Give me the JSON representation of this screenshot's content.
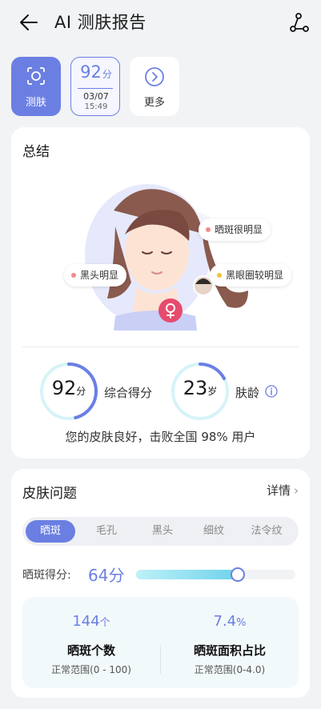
{
  "header": {
    "title": "AI 测肤报告"
  },
  "chips": {
    "scan_label": "测肤",
    "score_value": "92",
    "score_unit": "分",
    "date": "03/07",
    "time": "15:49",
    "more_label": "更多"
  },
  "summary": {
    "title": "总结",
    "bubbles": [
      "晒斑很明显",
      "黑头明显",
      "黑眼圈较明显"
    ],
    "score_value": "92",
    "score_unit": "分",
    "score_label": "综合得分",
    "score_fraction": 0.92,
    "age_value": "23",
    "age_unit": "岁",
    "age_label": "肤龄",
    "line": "您的皮肤良好，击败全国 98% 用户"
  },
  "issues": {
    "title": "皮肤问题",
    "detail_label": "详情",
    "tabs": [
      "晒斑",
      "毛孔",
      "黑头",
      "细纹",
      "法令纹"
    ],
    "active_tab": "晒斑",
    "score_label": "晒斑得分:",
    "score_value": "64分",
    "score_fraction": 0.64,
    "stats": [
      {
        "value": "144",
        "unit": "个",
        "label": "晒斑个数",
        "range": "正常范围(0 - 100)"
      },
      {
        "value": "7.4",
        "unit": "%",
        "label": "晒斑面积占比",
        "range": "正常范围(0-4.0)"
      }
    ]
  },
  "colors": {
    "accent": "#6b7fe3",
    "ring_light": "#d6f3f8",
    "bar_fill": "#6fd2eb",
    "female_badge": "#e64b6e"
  }
}
